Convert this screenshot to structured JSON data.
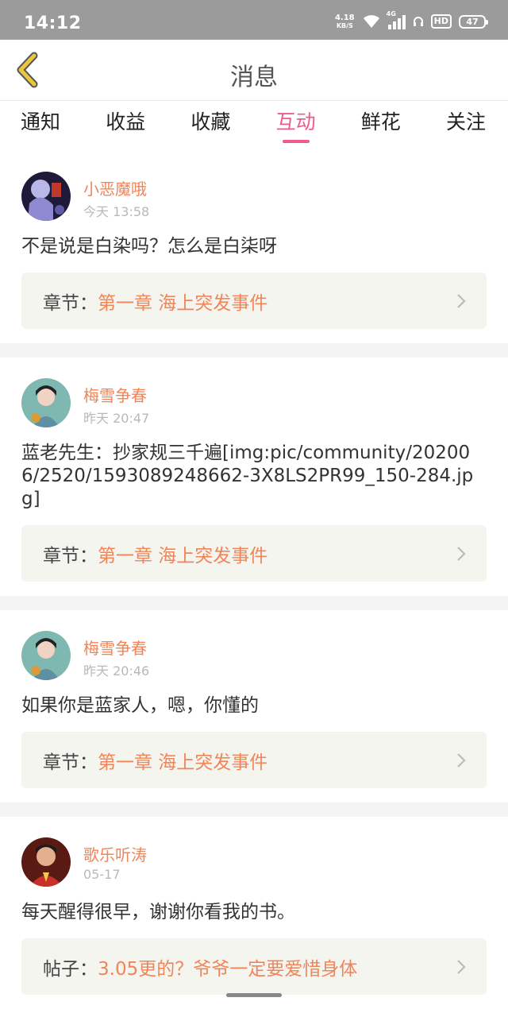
{
  "status_bar": {
    "time": "14:12",
    "net_speed": "4.18",
    "net_speed_unit": "KB/S",
    "network_type": "4G",
    "hd_label": "HD",
    "battery": "47"
  },
  "header": {
    "title": "消息",
    "back_icon": "chevron-left-icon"
  },
  "tabs": [
    {
      "label": "通知",
      "active": false
    },
    {
      "label": "收益",
      "active": false
    },
    {
      "label": "收藏",
      "active": false
    },
    {
      "label": "互动",
      "active": true
    },
    {
      "label": "鲜花",
      "active": false
    },
    {
      "label": "关注",
      "active": false
    }
  ],
  "colors": {
    "accent_pink": "#ee5c8a",
    "accent_orange": "#f0855a",
    "back_icon_yellow": "#e8c640"
  },
  "messages": [
    {
      "username": "小恶魔哦",
      "time": "今天 13:58",
      "text": "不是说是白染吗？怎么是白柒呀",
      "link_key": "章节：",
      "link_title": "第一章 海上突发事件"
    },
    {
      "username": "梅雪争春",
      "time": "昨天 20:47",
      "text": "蓝老先生：抄家规三千遍[img:pic/community/202006/2520/1593089248662-3X8LS2PR99_150-284.jpg]",
      "link_key": "章节：",
      "link_title": "第一章 海上突发事件"
    },
    {
      "username": "梅雪争春",
      "time": "昨天 20:46",
      "text": "如果你是蓝家人，嗯，你懂的",
      "link_key": "章节：",
      "link_title": "第一章 海上突发事件"
    },
    {
      "username": "歌乐听涛",
      "time": "05-17",
      "text": "每天醒得很早，谢谢你看我的书。",
      "link_key": "帖子：",
      "link_title": "3.05更的？爷爷一定要爱惜身体"
    }
  ]
}
